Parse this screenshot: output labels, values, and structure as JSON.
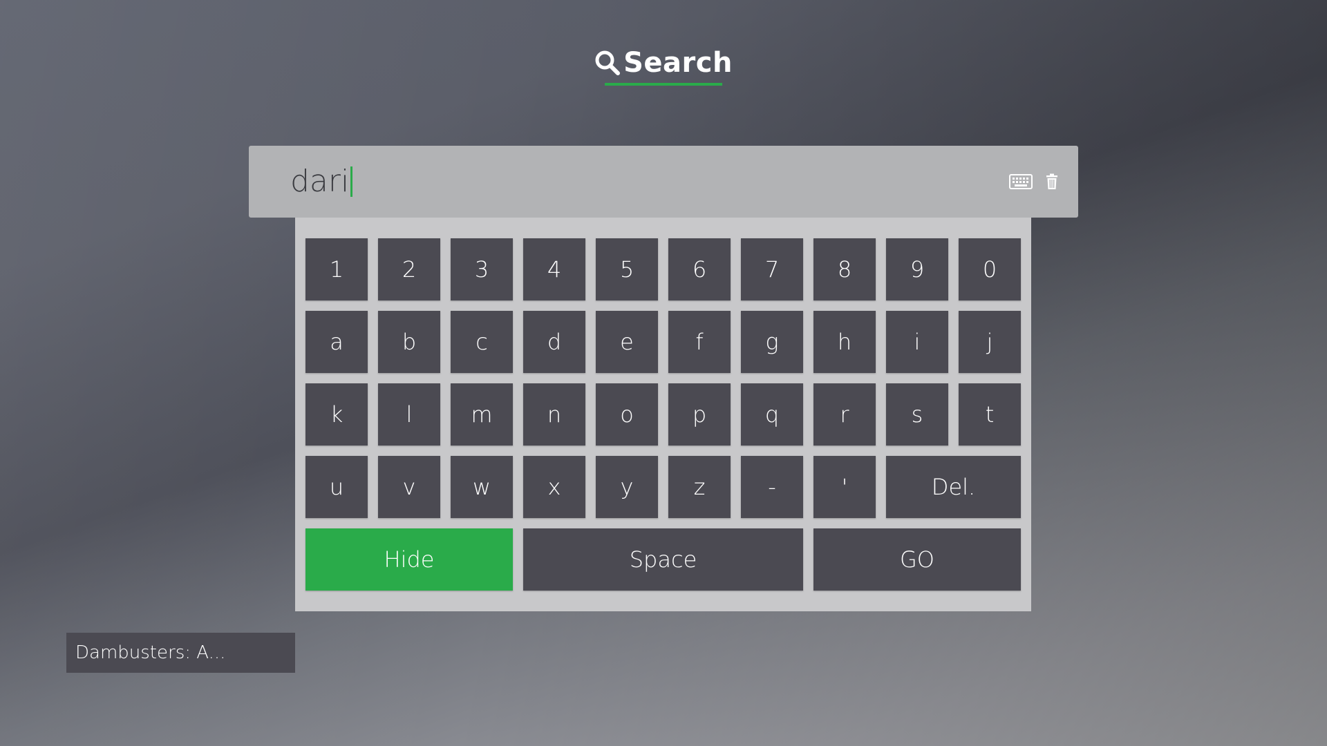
{
  "header": {
    "search_tab_label": "Search",
    "search_icon": "search-icon",
    "accent_color": "#2aab4a"
  },
  "search_field": {
    "value": "dari",
    "keyboard_icon": "keyboard-icon",
    "clear_icon": "trash-icon"
  },
  "keyboard": {
    "rows": [
      [
        "1",
        "2",
        "3",
        "4",
        "5",
        "6",
        "7",
        "8",
        "9",
        "0"
      ],
      [
        "a",
        "b",
        "c",
        "d",
        "e",
        "f",
        "g",
        "h",
        "i",
        "j"
      ],
      [
        "k",
        "l",
        "m",
        "n",
        "o",
        "p",
        "q",
        "r",
        "s",
        "t"
      ],
      [
        "u",
        "v",
        "w",
        "x",
        "y",
        "z",
        "-",
        "'"
      ]
    ],
    "delete_label": "Del.",
    "hide_label": "Hide",
    "space_label": "Space",
    "go_label": "GO",
    "key_color": "#4b4a52",
    "hide_color": "#2aab4a"
  },
  "results": [
    {
      "title": "Dambusters: A..."
    }
  ]
}
